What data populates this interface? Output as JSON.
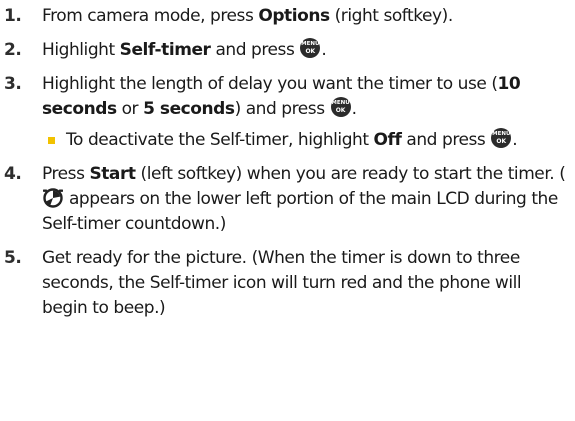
{
  "menu_ok_key": {
    "top": "MENU",
    "bottom": "OK",
    "icon": "menu-ok-key-icon"
  },
  "timer_icon": "self-timer-icon",
  "colors": {
    "bullet": "#f2c200",
    "key": "#2b2b2b"
  },
  "steps": [
    {
      "num": "1.",
      "t1": "From camera mode, press ",
      "b1": "Options",
      "t2": " (right softkey)."
    },
    {
      "num": "2.",
      "t1": "Highlight ",
      "b1": "Self-timer",
      "t2": " and press ",
      "t3": "."
    },
    {
      "num": "3.",
      "t1": "Highlight the length of delay you want the timer to use (",
      "b1": "10 seconds",
      "t2": " or ",
      "b2": "5 seconds",
      "t3": ") and press ",
      "t4": ".",
      "sub": {
        "t1": "To deactivate the Self-timer, highlight ",
        "b1": "Off",
        "t2": " and press ",
        "t3": "."
      }
    },
    {
      "num": "4.",
      "t1": "Press ",
      "b1": "Start",
      "t2": " (left softkey) when you are ready to start the timer. (",
      "t3": " appears on the lower left portion of the main LCD during the Self-timer countdown.)"
    },
    {
      "num": "5.",
      "t1": "Get ready for the picture. (When the timer is down to three seconds, the Self-timer icon will turn red and the phone will begin to beep.)"
    }
  ]
}
